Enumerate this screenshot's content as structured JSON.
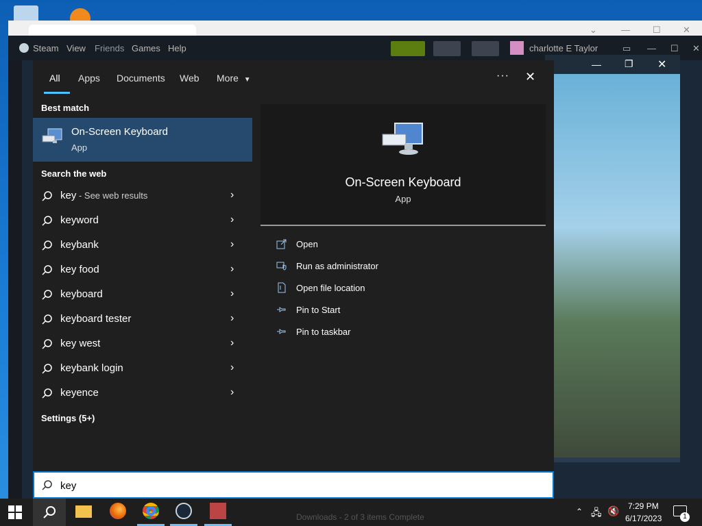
{
  "colors": {
    "accent": "#4cc2ff",
    "selected_bg": "#264a6e",
    "panel_bg": "#1f1f1f",
    "taskbar_bg": "#1e1e1e"
  },
  "steam": {
    "menu": [
      "Steam",
      "View",
      "Friends",
      "Games",
      "Help"
    ],
    "user": "charlotte E Taylor"
  },
  "search": {
    "tabs": [
      "All",
      "Apps",
      "Documents",
      "Web",
      "More"
    ],
    "more_icon": "more-dots-icon",
    "close_icon": "close-icon",
    "best_match_heading": "Best match",
    "best_match": {
      "name": "On-Screen Keyboard",
      "kind": "App"
    },
    "web_heading": "Search the web",
    "web_first": {
      "term": "key",
      "suffix": " - See web results"
    },
    "suggestions": [
      "keyword",
      "keybank",
      "key food",
      "keyboard",
      "keyboard tester",
      "key west",
      "keybank login",
      "keyence"
    ],
    "settings_heading": "Settings (5+)",
    "preview": {
      "name": "On-Screen Keyboard",
      "kind": "App"
    },
    "actions": [
      "Open",
      "Run as administrator",
      "Open file location",
      "Pin to Start",
      "Pin to taskbar"
    ],
    "query": "key"
  },
  "taskbar": {
    "time": "7:29 PM",
    "date": "6/17/2023",
    "notification_count": "1",
    "background_text": "Downloads - 2 of 3 items Complete"
  }
}
